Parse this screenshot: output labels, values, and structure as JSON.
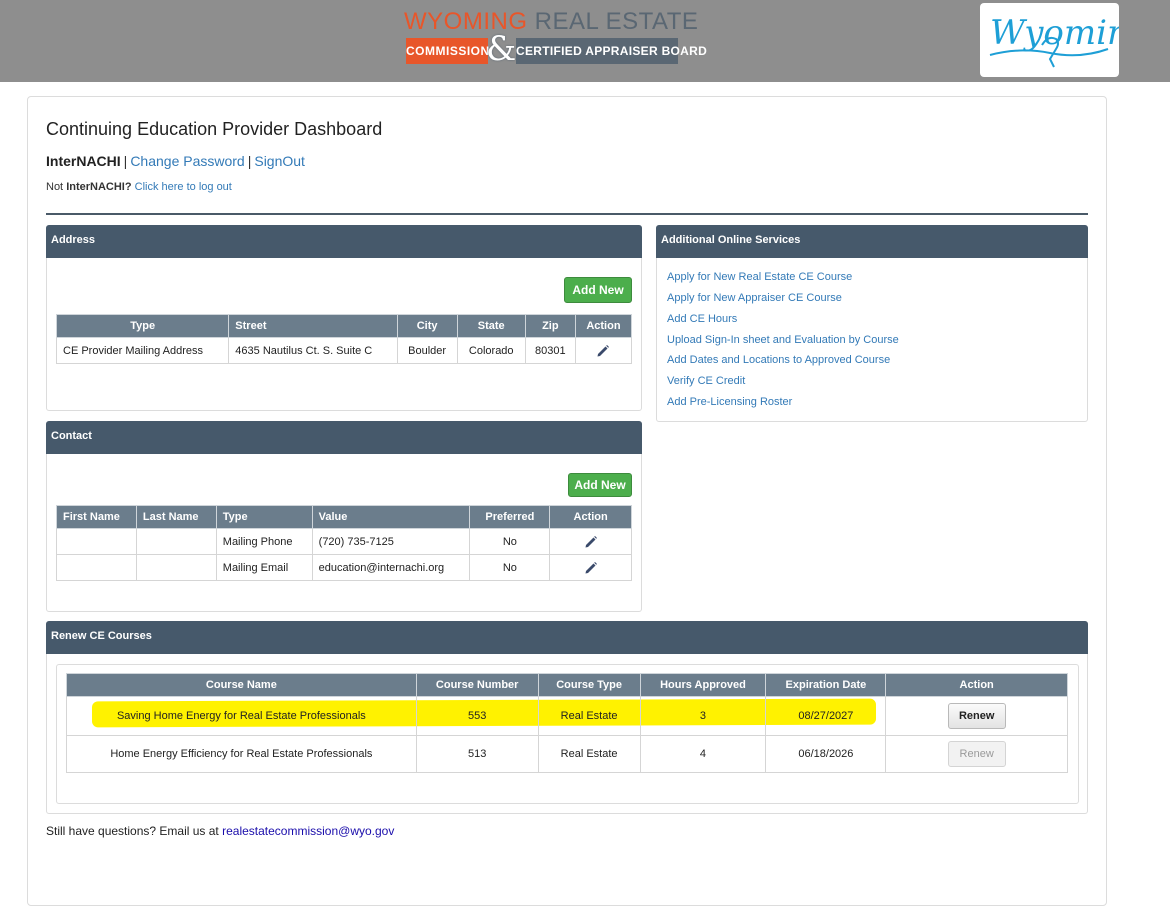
{
  "header": {
    "logo_line1_a": "WYOMING",
    "logo_line1_b": "REAL ESTATE",
    "logo_commission": "COMMISSION",
    "logo_amp": "&",
    "logo_board": "CERTIFIED APPRAISER BOARD",
    "badge_text": "Wyoming",
    "colors": {
      "bar": "#8e8e8e",
      "orange": "#e8562a",
      "slate": "#5a6773",
      "badge_blue": "#1e9fd6"
    }
  },
  "page": {
    "title": "Continuing Education Provider Dashboard",
    "user_name": "InterNACHI",
    "sep": "|",
    "change_password": "Change Password",
    "signout": "SignOut",
    "not_prefix": "Not ",
    "not_user": "InterNACHI?",
    "logout_link": "Click here to log out"
  },
  "address": {
    "title": "Address",
    "add_label": "Add New",
    "columns": [
      "Type",
      "Street",
      "City",
      "State",
      "Zip",
      "Action"
    ],
    "rows": [
      {
        "type": "CE Provider Mailing Address",
        "street": "4635 Nautilus Ct. S. Suite C",
        "city": "Boulder",
        "state": "Colorado",
        "zip": "80301"
      }
    ]
  },
  "contact": {
    "title": "Contact",
    "add_label": "Add New",
    "columns": [
      "First Name",
      "Last Name",
      "Type",
      "Value",
      "Preferred",
      "Action"
    ],
    "rows": [
      {
        "first": "",
        "last": "",
        "type": "Mailing Phone",
        "value": "(720) 735-7125",
        "preferred": "No"
      },
      {
        "first": "",
        "last": "",
        "type": "Mailing Email",
        "value": "education@internachi.org",
        "preferred": "No"
      }
    ]
  },
  "services": {
    "title": "Additional Online Services",
    "links": [
      "Apply for New Real Estate CE Course",
      "Apply for New Appraiser CE Course",
      "Add CE Hours",
      "Upload Sign-In sheet and Evaluation by Course",
      "Add Dates and Locations to Approved Course",
      "Verify CE Credit",
      "Add Pre-Licensing Roster"
    ]
  },
  "renew": {
    "title": "Renew CE Courses",
    "columns": [
      "Course Name",
      "Course Number",
      "Course Type",
      "Hours Approved",
      "Expiration Date",
      "Action"
    ],
    "rows": [
      {
        "name": "Saving Home Energy for Real Estate Professionals",
        "number": "553",
        "type": "Real Estate",
        "hours": "3",
        "expiration": "08/27/2027",
        "action": "Renew",
        "enabled": true
      },
      {
        "name": "Home Energy Efficiency for Real Estate Professionals",
        "number": "513",
        "type": "Real Estate",
        "hours": "4",
        "expiration": "06/18/2026",
        "action": "Renew",
        "enabled": false
      }
    ],
    "highlight_color": "#fff200"
  },
  "footer": {
    "question": "Still have questions? Email us at ",
    "email": "realestatecommission@wyo.gov"
  },
  "icons": {
    "edit": "pencil-icon",
    "badge": "cowboy-logo-icon"
  },
  "colors": {
    "panel_head": "#46596b",
    "table_head": "#6b7d8c",
    "link": "#337ab7",
    "button_green": "#4cae4c"
  }
}
